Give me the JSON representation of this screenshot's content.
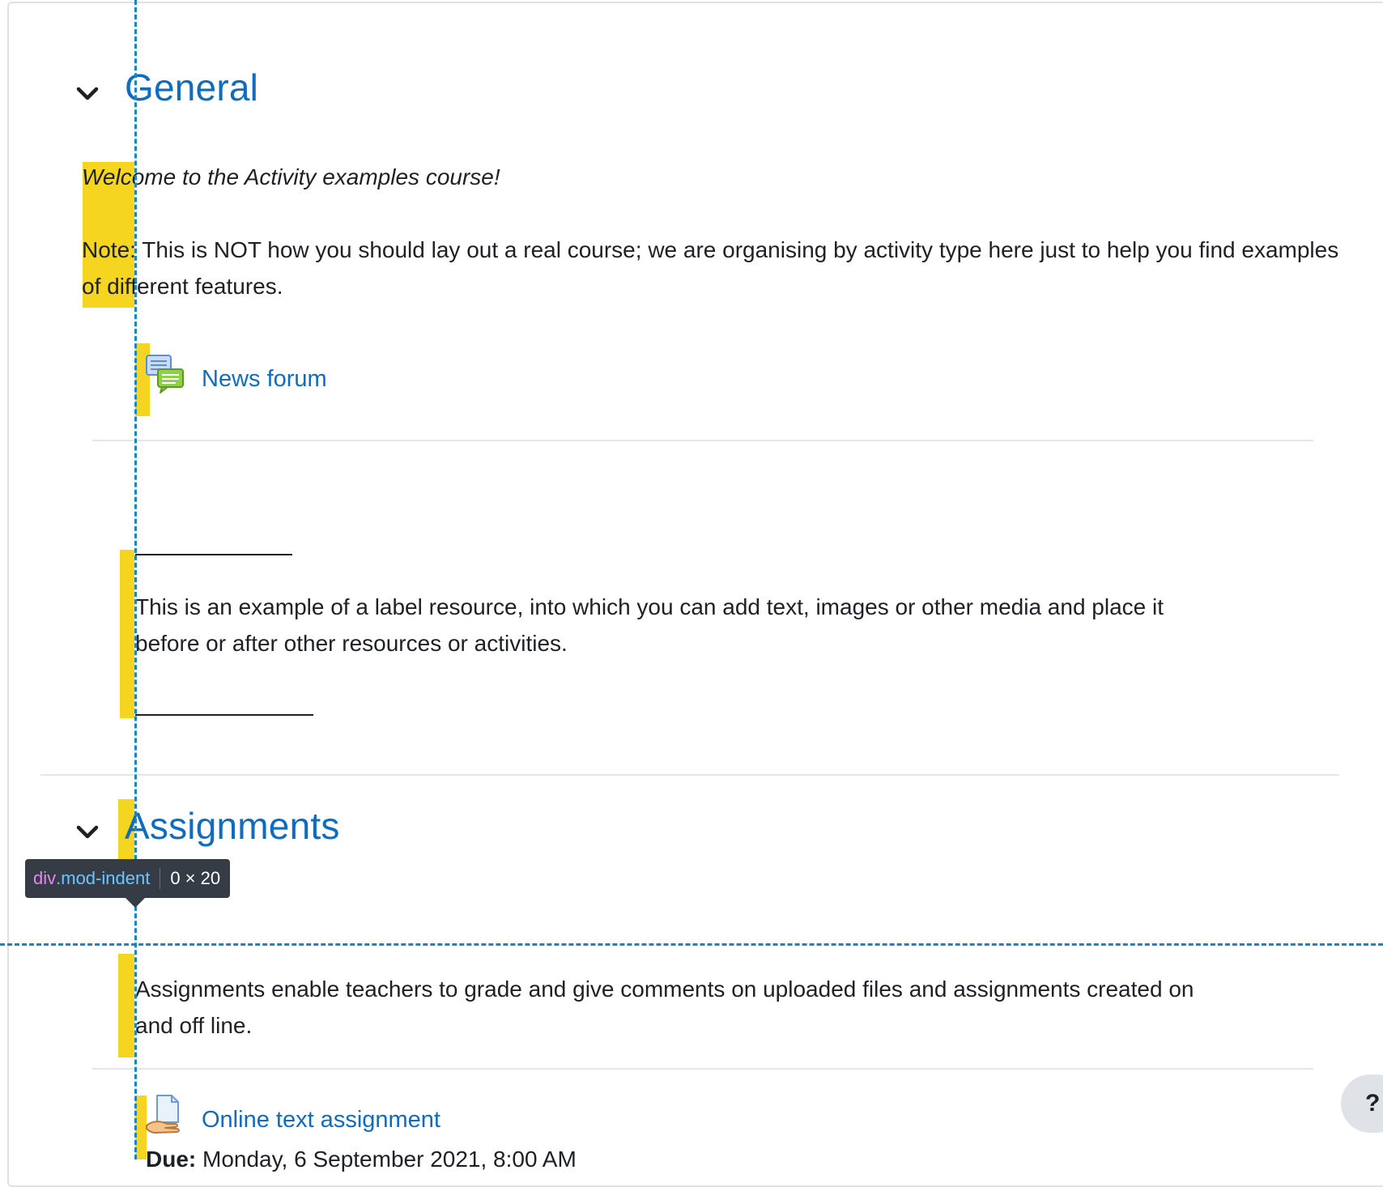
{
  "sections": [
    {
      "title": "General"
    },
    {
      "title": "Assignments"
    }
  ],
  "general": {
    "welcome_text": "Welcome to the Activity examples course!",
    "note_label": "Note",
    "note_text": ": This is NOT how you should lay out a real course; we are organising by activity type here just to help you find examples of different features.",
    "news_forum_link": "News forum",
    "label_text": "This is an example of a label resource, into which you can add text, images or other media and place it before or after other resources or activities."
  },
  "assignments": {
    "description": "Assignments enable teachers to grade and give comments on uploaded files and assignments created on and off line.",
    "online_text_link": "Online text assignment",
    "due_label": "Due:",
    "due_value": " Monday, 6 September 2021, 8:00 AM"
  },
  "devtools_tooltip": {
    "tag": "div",
    "class": ".mod-indent",
    "dims": "0 × 20"
  },
  "help_button": {
    "label": "?"
  },
  "icons": {
    "collapse": "chevron-down-icon",
    "forum": "forum-icon",
    "assignment": "assignment-icon"
  },
  "colors": {
    "link": "#0f6cbf",
    "highlight": "#f5d51f",
    "guide": "#1a86c0",
    "tooltip_bg": "#363c45"
  }
}
